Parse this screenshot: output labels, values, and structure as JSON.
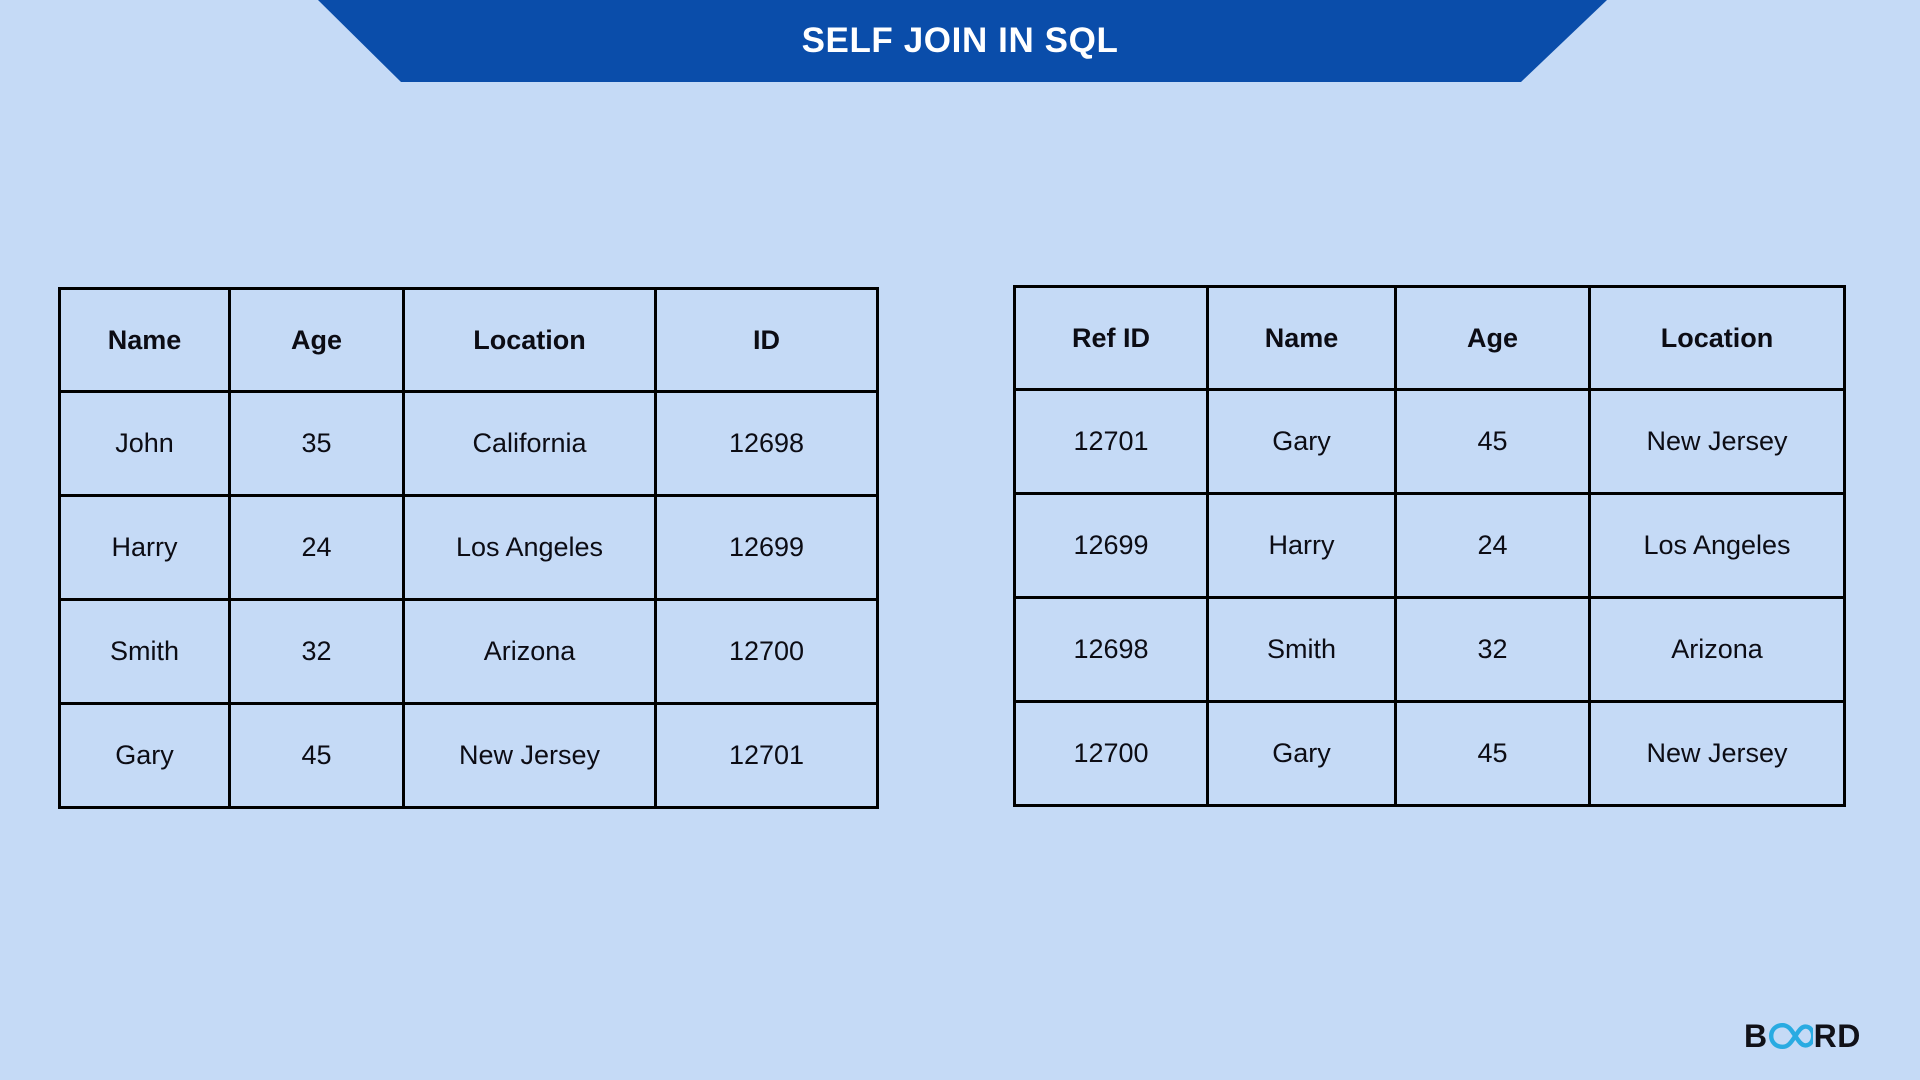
{
  "page": {
    "background_color": "#C5DAF6",
    "banner_color": "#0A4DAA",
    "border_color": "#000000",
    "text_color": "#0C0C14"
  },
  "header": {
    "title": "SELF JOIN IN SQL"
  },
  "tables": {
    "left": {
      "name": "employee-table",
      "columns": [
        "Name",
        "Age",
        "Location",
        "ID"
      ],
      "rows": [
        [
          "John",
          "35",
          "California",
          "12698"
        ],
        [
          "Harry",
          "24",
          "Los Angeles",
          "12699"
        ],
        [
          "Smith",
          "32",
          "Arizona",
          "12700"
        ],
        [
          "Gary",
          "45",
          "New Jersey",
          "12701"
        ]
      ]
    },
    "right": {
      "name": "reference-table",
      "columns": [
        "Ref ID",
        "Name",
        "Age",
        "Location"
      ],
      "rows": [
        [
          "12701",
          "Gary",
          "45",
          "New Jersey"
        ],
        [
          "12699",
          "Harry",
          "24",
          "Los Angeles"
        ],
        [
          "12698",
          "Smith",
          "32",
          "Arizona"
        ],
        [
          "12700",
          "Gary",
          "45",
          "New Jersey"
        ]
      ]
    }
  },
  "logo": {
    "prefix": "B",
    "suffix": "RD",
    "icon": "infinity-icon",
    "icon_color": "#29ABE2",
    "text_color": "#111118"
  }
}
